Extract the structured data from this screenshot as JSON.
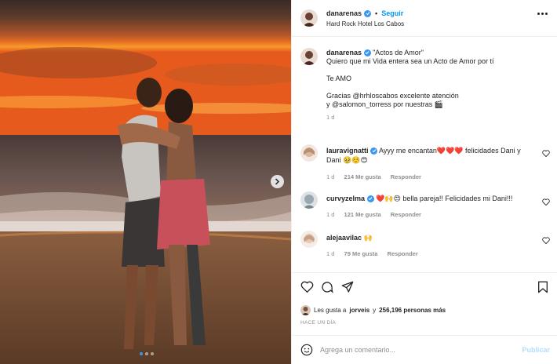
{
  "post": {
    "username": "danarenas",
    "follow_label": "Seguir",
    "separator": "•",
    "location": "Hard Rock Hotel Los Cabos",
    "caption": {
      "username": "danarenas",
      "line1": "\"Actos de Amor\"",
      "line2": "Quiero que mi Vida entera sea un Acto de Amor por tí",
      "line3": "Te AMO",
      "line4": "Gracias @hrhloscabos excelente atención",
      "line5": "y @salomon_torress por nuestras 🎬",
      "time": "1 d"
    },
    "comments": [
      {
        "username": "lauravignatti",
        "text": "Ayyy me encantan❤️❤️❤️ felicidades Dani y Dani 🥹☺️😍",
        "time": "1 d",
        "likes": "214 Me gusta",
        "reply": "Responder"
      },
      {
        "username": "curvyzelma",
        "text": "❤️🙌😍 bella pareja!! Felicidades mi Dani!!!",
        "time": "1 d",
        "likes": "121 Me gusta",
        "reply": "Responder"
      },
      {
        "username": "alejaavilac",
        "text": "🙌",
        "time": "1 d",
        "likes": "79 Me gusta",
        "reply": "Responder"
      }
    ],
    "likes_text_prefix": "Les gusta a",
    "likes_user": "jorveis",
    "likes_text_mid": "y",
    "likes_count": "256,196 personas más",
    "posted_ago": "HACE UN DÍA",
    "comment_placeholder": "Agrega un comentario...",
    "publish_label": "Publicar",
    "carousel_dots": 3,
    "carousel_active": 1
  },
  "colors": {
    "accent": "#0095f6",
    "verified": "#3897f0",
    "muted": "#8e8e8e",
    "publish_disabled": "#b2dffc"
  },
  "icons": [
    "verified-badge-icon",
    "more-options-icon",
    "heart-icon",
    "comment-icon",
    "share-icon",
    "bookmark-icon",
    "emoji-icon",
    "next-arrow-icon"
  ]
}
